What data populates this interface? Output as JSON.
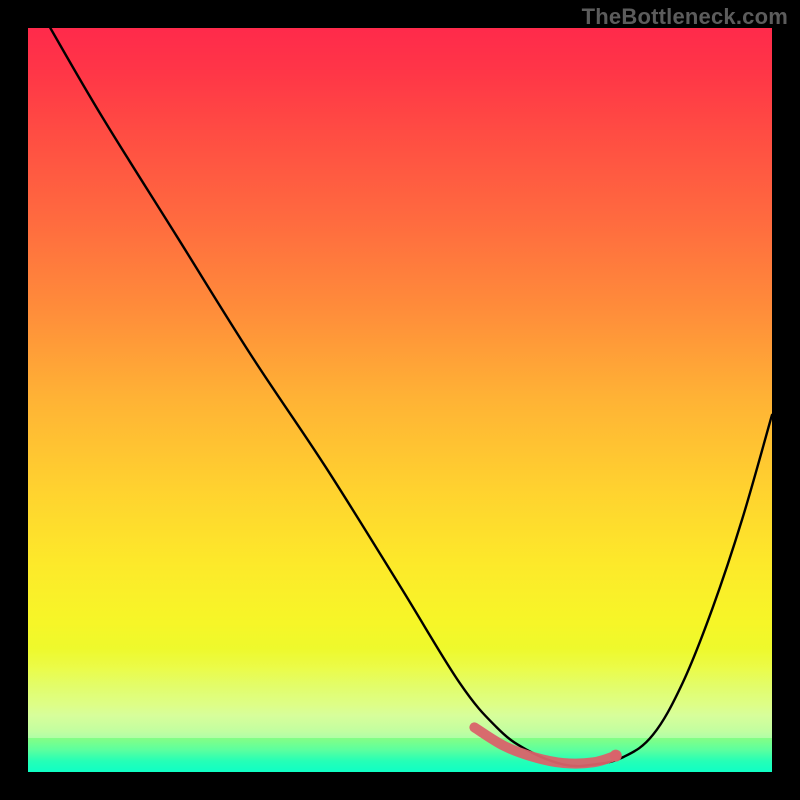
{
  "watermark": "TheBottleneck.com",
  "chart_data": {
    "type": "line",
    "title": "",
    "xlabel": "",
    "ylabel": "",
    "xlim": [
      0,
      100
    ],
    "ylim": [
      0,
      100
    ],
    "series": [
      {
        "name": "bottleneck-curve",
        "x": [
          3,
          10,
          20,
          30,
          40,
          50,
          58,
          63,
          67,
          72,
          76,
          80,
          84,
          88,
          92,
          96,
          100
        ],
        "values": [
          100,
          88,
          72,
          56,
          41,
          25,
          12,
          6,
          3,
          1,
          1,
          2,
          5,
          12,
          22,
          34,
          48
        ]
      }
    ],
    "highlight": {
      "name": "optimal-range",
      "x": [
        60,
        64,
        68,
        72,
        76,
        79
      ],
      "values": [
        6,
        3.5,
        2,
        1.2,
        1.3,
        2.2
      ]
    },
    "highlight_end_point": {
      "x": 79,
      "y": 2.2
    },
    "colors": {
      "curve": "#000000",
      "highlight": "#d9636a",
      "marker": "#d9636a",
      "background_top": "#ff2a4b",
      "background_bottom": "#0fffc5"
    }
  }
}
